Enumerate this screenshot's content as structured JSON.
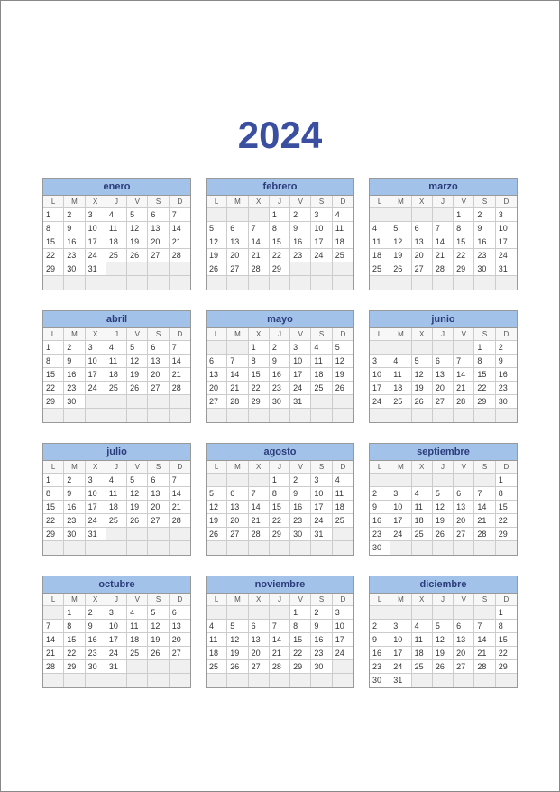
{
  "year": "2024",
  "weekday_headers": [
    "L",
    "M",
    "X",
    "J",
    "V",
    "S",
    "D"
  ],
  "months": [
    {
      "name": "enero",
      "start": 0,
      "days": 31
    },
    {
      "name": "febrero",
      "start": 3,
      "days": 29
    },
    {
      "name": "marzo",
      "start": 4,
      "days": 31
    },
    {
      "name": "abril",
      "start": 0,
      "days": 30
    },
    {
      "name": "mayo",
      "start": 2,
      "days": 31
    },
    {
      "name": "junio",
      "start": 5,
      "days": 30
    },
    {
      "name": "julio",
      "start": 0,
      "days": 31
    },
    {
      "name": "agosto",
      "start": 3,
      "days": 31
    },
    {
      "name": "septiembre",
      "start": 6,
      "days": 30
    },
    {
      "name": "octubre",
      "start": 1,
      "days": 31
    },
    {
      "name": "noviembre",
      "start": 4,
      "days": 30
    },
    {
      "name": "diciembre",
      "start": 6,
      "days": 31
    }
  ]
}
